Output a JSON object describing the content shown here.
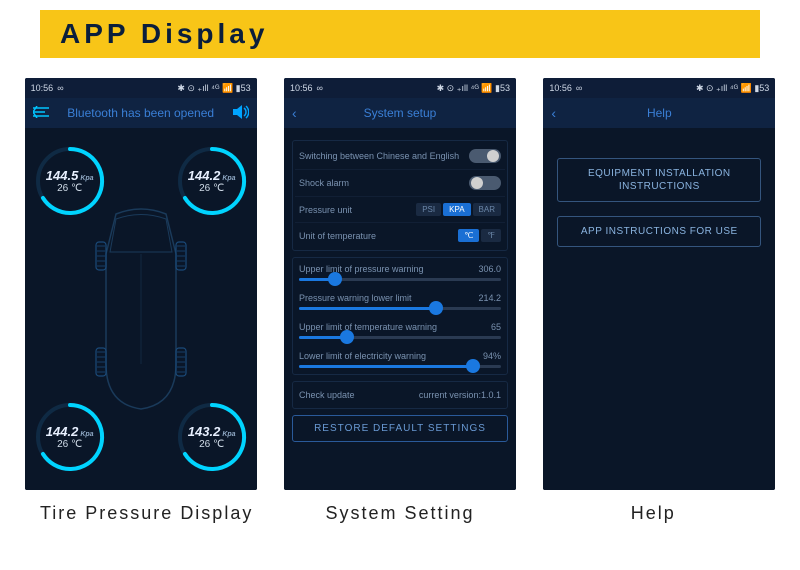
{
  "banner": {
    "title": "APP Display"
  },
  "status_bar": {
    "time": "10:56",
    "infinity": "∞",
    "icons_right": "✱ ⊙ ₊ıll ⁴ᴳ 📶 ▮53"
  },
  "screen1": {
    "header": {
      "title": "Bluetooth has been opened"
    },
    "tires": {
      "tl": {
        "pressure": "144.5",
        "unit": "Kpa",
        "temp": "26 ℃"
      },
      "tr": {
        "pressure": "144.2",
        "unit": "Kpa",
        "temp": "26 ℃"
      },
      "bl": {
        "pressure": "144.2",
        "unit": "Kpa",
        "temp": "26 ℃"
      },
      "br": {
        "pressure": "143.2",
        "unit": "Kpa",
        "temp": "26 ℃"
      }
    }
  },
  "screen2": {
    "header": {
      "title": "System setup"
    },
    "rows": {
      "language": "Switching between Chinese and English",
      "shock": "Shock alarm",
      "pressure_unit": "Pressure unit",
      "pressure_opts": [
        "PSI",
        "KPA",
        "BAR"
      ],
      "temp_unit": "Unit of temperature",
      "temp_opts": [
        "℃",
        "℉"
      ]
    },
    "sliders": {
      "upper_pressure": {
        "label": "Upper limit of pressure warning",
        "value": "306.0",
        "pct": 18
      },
      "lower_pressure": {
        "label": "Pressure warning lower limit",
        "value": "214.2",
        "pct": 68
      },
      "upper_temp": {
        "label": "Upper limit of temperature warning",
        "value": "65",
        "pct": 24
      },
      "lower_elec": {
        "label": "Lower limit of electricity warning",
        "value": "94%",
        "pct": 86
      }
    },
    "update": {
      "label": "Check update",
      "version_label": "current version:",
      "version": "1.0.1"
    },
    "restore": "RESTORE DEFAULT SETTINGS"
  },
  "screen3": {
    "header": {
      "title": "Help"
    },
    "buttons": {
      "install": "EQUIPMENT INSTALLATION INSTRUCTIONS",
      "app": "APP INSTRUCTIONS FOR USE"
    }
  },
  "captions": {
    "s1": "Tire Pressure Display",
    "s2": "System Setting",
    "s3": "Help"
  }
}
